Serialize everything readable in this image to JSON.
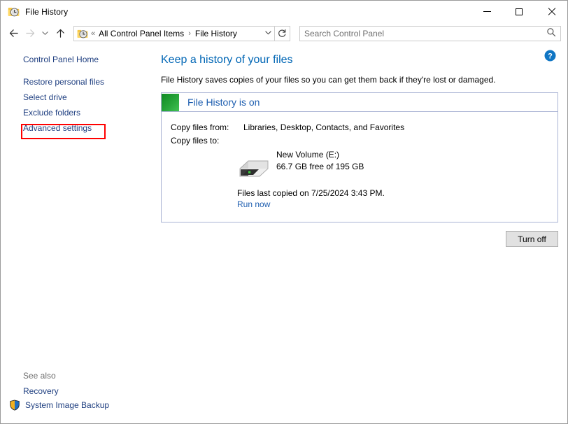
{
  "window": {
    "title": "File History",
    "icon": "file-history-icon",
    "controls": {
      "minimize": "Minimize",
      "maximize": "Maximize",
      "close": "Close"
    }
  },
  "navbar": {
    "back": "Back",
    "forward": "Forward",
    "recent_dropdown": "Recent locations",
    "up": "Up one level",
    "address_icon": "file-history-icon",
    "breadcrumb_overflow": "«",
    "breadcrumbs": [
      {
        "label": "All Control Panel Items"
      },
      {
        "label": "File History"
      }
    ],
    "breadcrumb_separator": "›",
    "address_dropdown": "⌄",
    "refresh": "↻",
    "search": {
      "placeholder": "Search Control Panel",
      "value": "",
      "icon": "search-icon"
    }
  },
  "sidebar": {
    "items": [
      {
        "label": "Control Panel Home",
        "highlighted": false
      },
      {
        "label": "Restore personal files",
        "highlighted": true
      },
      {
        "label": "Select drive",
        "highlighted": false
      },
      {
        "label": "Exclude folders",
        "highlighted": false
      },
      {
        "label": "Advanced settings",
        "highlighted": false
      }
    ],
    "see_also": {
      "title": "See also",
      "items": [
        {
          "label": "Recovery",
          "icon": null
        },
        {
          "label": "System Image Backup",
          "icon": "shield-icon"
        }
      ]
    }
  },
  "main": {
    "heading": "Keep a history of your files",
    "description": "File History saves copies of your files so you can get them back if they're lost or damaged.",
    "help_icon": "help-icon",
    "status_panel": {
      "indicator_color": "#27a53a",
      "status_text": "File History is on",
      "copy_from_label": "Copy files from:",
      "copy_from_value": "Libraries, Desktop, Contacts, and Favorites",
      "copy_to_label": "Copy files to:",
      "drive_icon": "external-drive-icon",
      "drive_name": "New Volume (E:)",
      "drive_space": "66.7 GB free of 195 GB",
      "last_copied": "Files last copied on 7/25/2024 3:43 PM.",
      "run_now": "Run now"
    },
    "turn_off_button": "Turn off"
  },
  "colors": {
    "accent_link": "#1f3f80",
    "heading": "#0066b5",
    "status_green": "#27a53a",
    "highlight_red": "#ff0000",
    "panel_border": "#aab4d4"
  }
}
